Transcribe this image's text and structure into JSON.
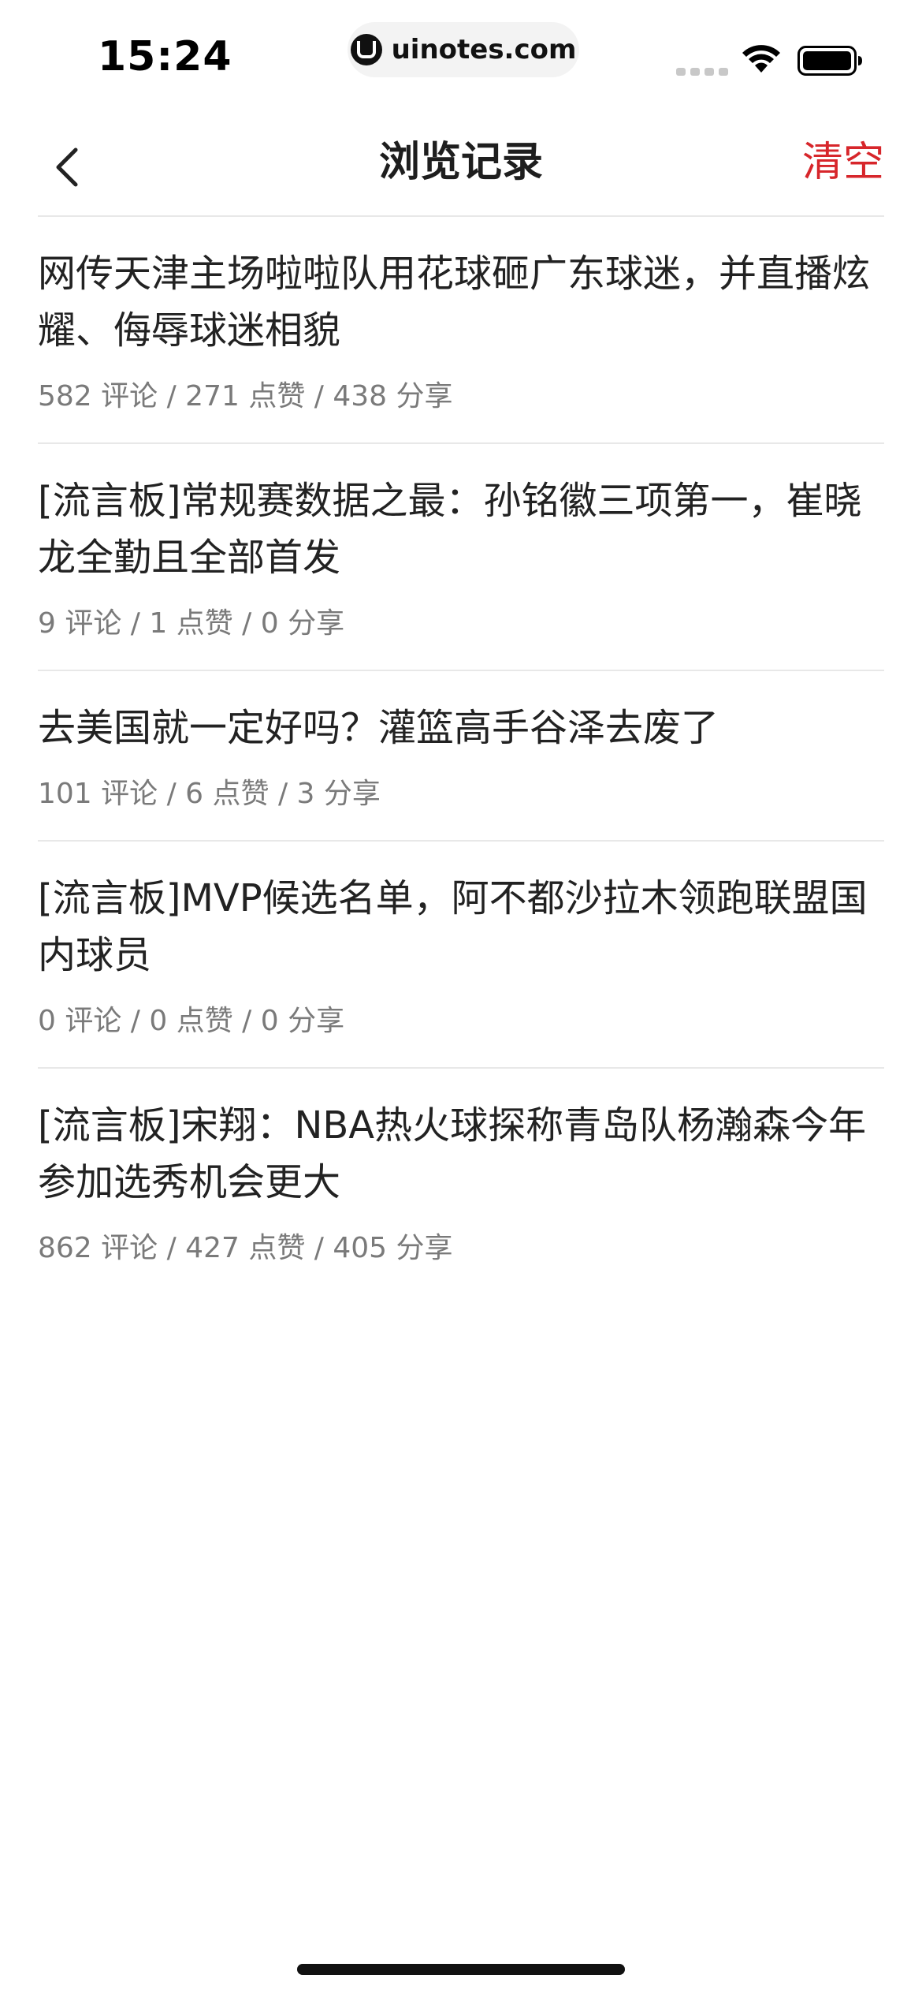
{
  "status_bar": {
    "time": "15:24",
    "url": "uinotes.com",
    "icons": [
      "signal-icon",
      "wifi-icon",
      "battery-icon"
    ]
  },
  "nav": {
    "back_icon": "chevron-left-icon",
    "title": "浏览记录",
    "clear_label": "清空"
  },
  "colors": {
    "accent": "#d7262b",
    "text_primary": "#222222",
    "text_secondary": "#7a7a7a",
    "divider": "#e8e8e8"
  },
  "history": [
    {
      "title": "网传天津主场啦啦队用花球砸广东球迷，并直播炫耀、侮辱球迷相貌",
      "stats": "582 评论 / 271 点赞 / 438 分享"
    },
    {
      "title": "[流言板]常规赛数据之最：孙铭徽三项第一，崔晓龙全勤且全部首发",
      "stats": "9 评论 / 1 点赞 / 0 分享"
    },
    {
      "title": "去美国就一定好吗？灌篮高手谷泽去废了",
      "stats": "101 评论 / 6 点赞 / 3 分享"
    },
    {
      "title": "[流言板]MVP候选名单，阿不都沙拉木领跑联盟国内球员",
      "stats": "0 评论 / 0 点赞 / 0 分享"
    },
    {
      "title": "[流言板]宋翔：NBA热火球探称青岛队杨瀚森今年参加选秀机会更大",
      "stats": "862 评论 / 427 点赞 / 405 分享"
    }
  ]
}
